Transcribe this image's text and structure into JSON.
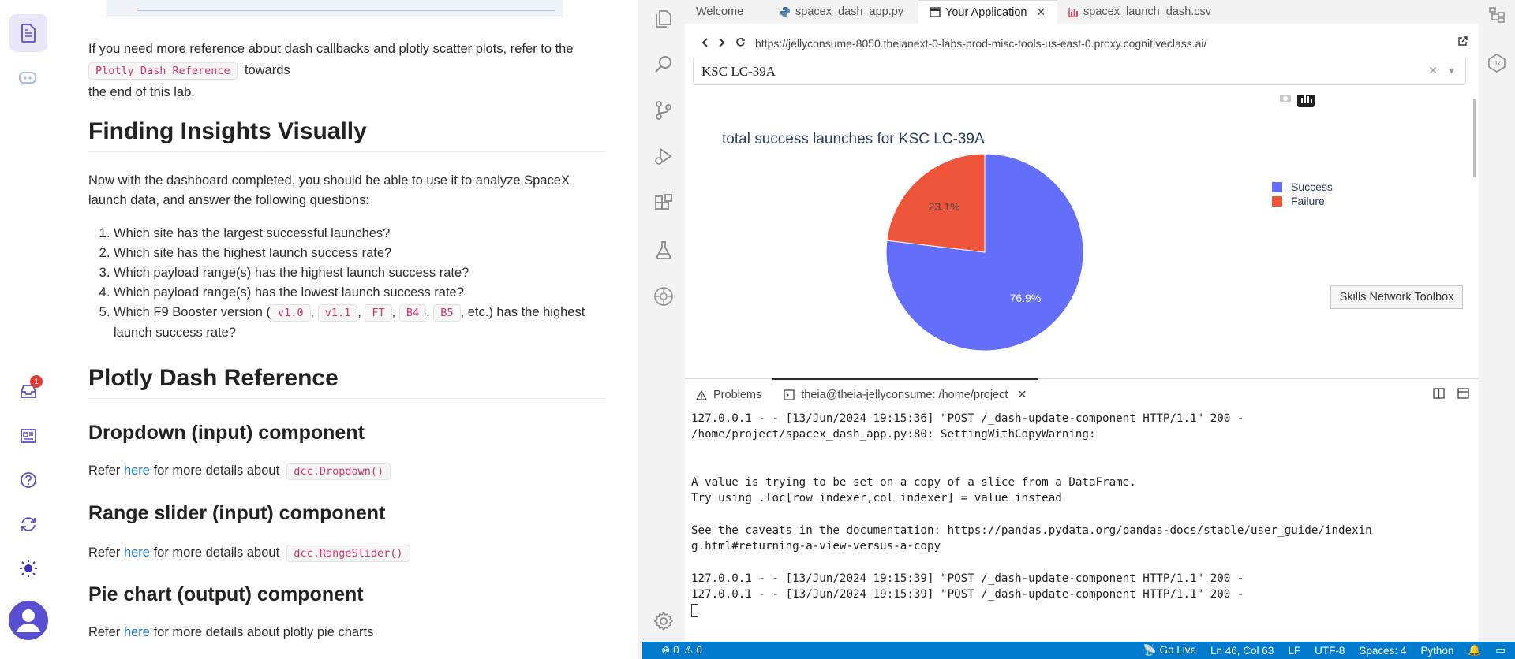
{
  "colors": {
    "accent": "#5b4fd1",
    "status_bar": "#007acc",
    "success": "#636efa",
    "failure": "#ef553b",
    "code_text": "#d6336c"
  },
  "left_rail": {
    "notification_count": "1"
  },
  "doc": {
    "para1_text": "If you need more reference about dash callbacks and plotly scatter plots, refer to the",
    "para1_code": "Plotly Dash Reference",
    "para1_after": "towards",
    "para1_line2": "the end of this lab.",
    "h_insights": "Finding Insights Visually",
    "insights_intro": "Now with the dashboard completed, you should be able to use it to analyze SpaceX launch data, and answer the following questions:",
    "questions": [
      "Which site has the largest successful launches?",
      "Which site has the highest launch success rate?",
      "Which payload range(s) has the highest launch success rate?",
      "Which payload range(s) has the lowest launch success rate?"
    ],
    "q5_prefix": "Which F9 Booster version (",
    "q5_codes": [
      "v1.0",
      "v1.1",
      "FT",
      "B4",
      "B5"
    ],
    "q5_sep": ",",
    "q5_suffix": ", etc.) has the highest launch success rate?",
    "h_reference": "Plotly Dash Reference",
    "h_dropdown": "Dropdown (input) component",
    "h_slider": "Range slider (input) component",
    "h_pie": "Pie chart (output) component",
    "refer": "Refer",
    "here": "here",
    "details": "for more details about",
    "code_dropdown": "dcc.Dropdown()",
    "code_slider": "dcc.RangeSlider()",
    "pie_details": "for more details about plotly pie charts"
  },
  "ide": {
    "tabs": [
      {
        "label": "Welcome",
        "icon": ""
      },
      {
        "label": "spacex_dash_app.py",
        "icon": "python-icon"
      },
      {
        "label": "Your Application",
        "icon": "window-icon"
      },
      {
        "label": "spacex_launch_dash.csv",
        "icon": "chart-file-icon"
      }
    ],
    "url": "https://jellyconsume-8050.theianext-0-labs-prod-misc-tools-us-east-0.proxy.cognitiveclass.ai/",
    "dropdown_value": "KSC LC-39A",
    "tooltip": "Skills Network Toolbox",
    "panel_tabs": {
      "problems": "Problems",
      "terminal": "theia@theia-jellyconsume: /home/project"
    },
    "terminal_lines": [
      "127.0.0.1 - - [13/Jun/2024 19:15:36] \"POST /_dash-update-component HTTP/1.1\" 200 -",
      "/home/project/spacex_dash_app.py:80: SettingWithCopyWarning:",
      "",
      "",
      "A value is trying to be set on a copy of a slice from a DataFrame.",
      "Try using .loc[row_indexer,col_indexer] = value instead",
      "",
      "See the caveats in the documentation: https://pandas.pydata.org/pandas-docs/stable/user_guide/indexin",
      "g.html#returning-a-view-versus-a-copy",
      "",
      "127.0.0.1 - - [13/Jun/2024 19:15:39] \"POST /_dash-update-component HTTP/1.1\" 200 -",
      "127.0.0.1 - - [13/Jun/2024 19:15:39] \"POST /_dash-update-component HTTP/1.1\" 200 -"
    ],
    "status": {
      "errors": "0",
      "warnings": "0",
      "go_live": "Go Live",
      "position": "Ln 46, Col 63",
      "eol": "LF",
      "encoding": "UTF-8",
      "spaces": "Spaces: 4",
      "language": "Python"
    }
  },
  "chart_data": {
    "type": "pie",
    "title": "total success launches for KSC LC-39A",
    "labels": [
      "Success",
      "Failure"
    ],
    "values": [
      76.9,
      23.1
    ],
    "value_labels": [
      "76.9%",
      "23.1%"
    ],
    "colors": [
      "#636efa",
      "#ef553b"
    ],
    "legend": "top-right"
  }
}
